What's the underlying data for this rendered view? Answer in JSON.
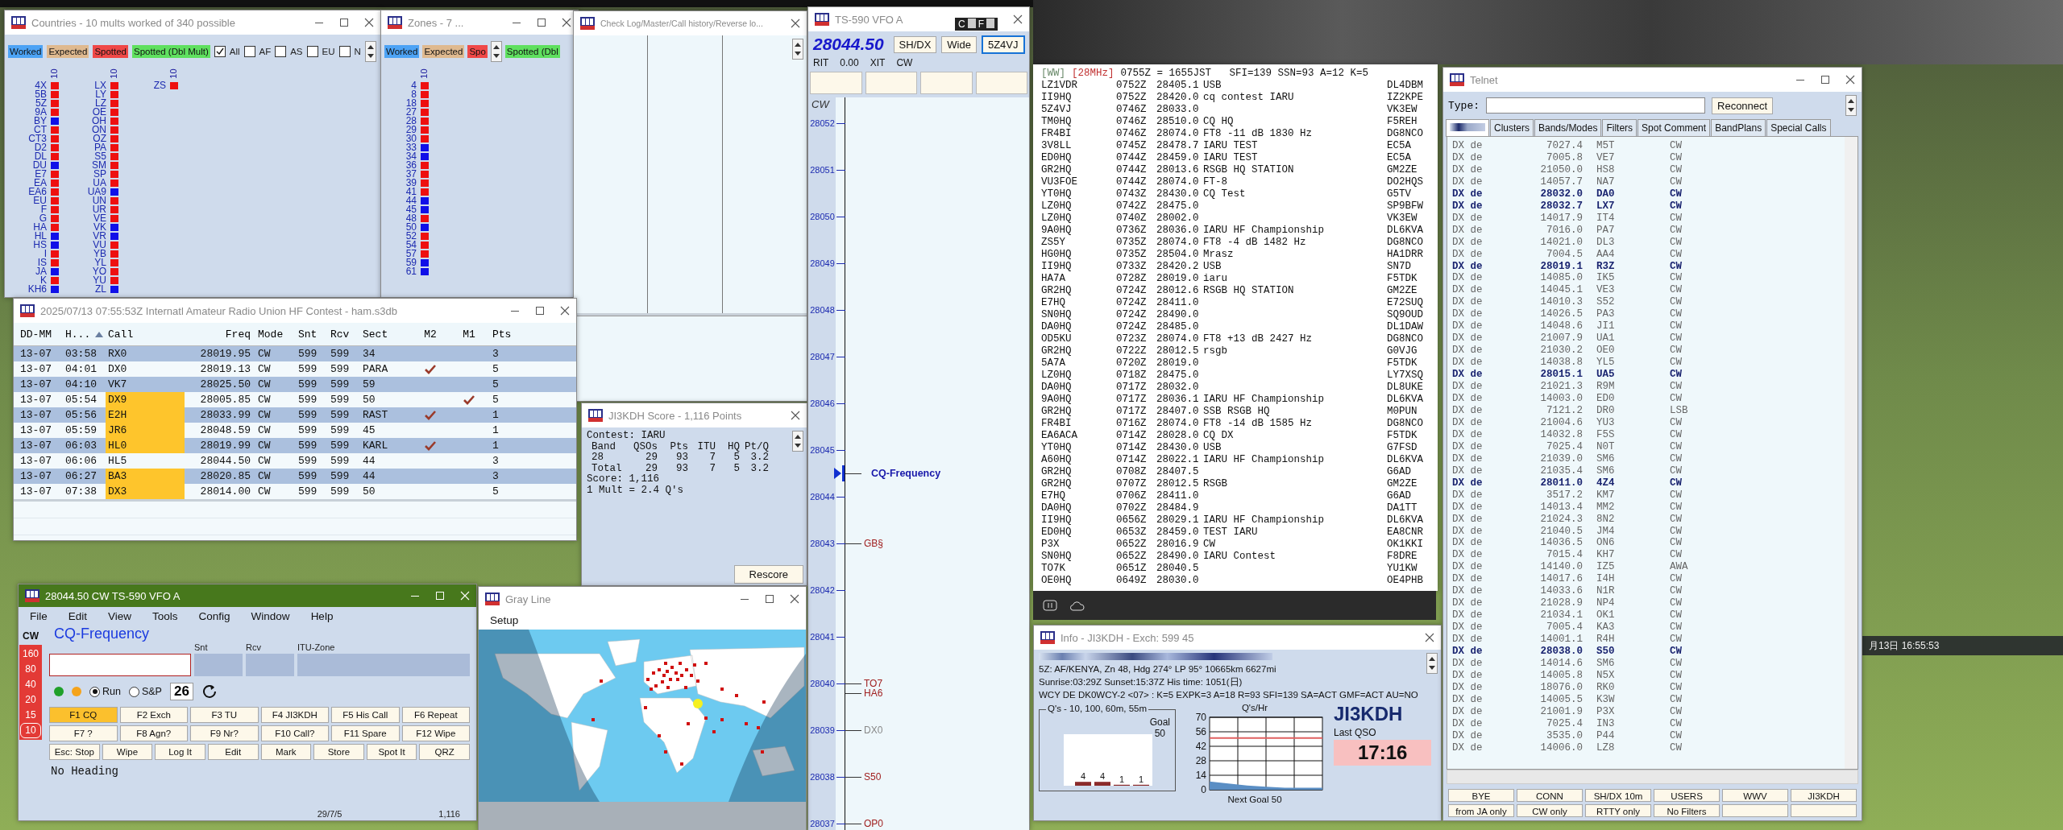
{
  "countries": {
    "title": "Countries - 10 mults worked of 340 possible",
    "legend": [
      {
        "label": "Worked",
        "color": "#4da3f5"
      },
      {
        "label": "Expected",
        "color": "#dfb98f"
      },
      {
        "label": "Spotted",
        "color": "#f04848"
      },
      {
        "label": "Spotted (Dbl Mult)",
        "color": "#5fe05f"
      }
    ],
    "filters": [
      {
        "label": "All",
        "checked": true
      },
      {
        "label": "AF",
        "checked": false
      },
      {
        "label": "AS",
        "checked": false
      },
      {
        "label": "EU",
        "checked": false
      },
      {
        "label": "N",
        "checked": false
      }
    ],
    "columns": [
      {
        "header": "10",
        "items": [
          {
            "label": "4X",
            "color": "#ee1010"
          },
          {
            "label": "5B",
            "color": "#ee1010"
          },
          {
            "label": "5Z",
            "color": "#ee1010"
          },
          {
            "label": "9A",
            "color": "#ee1010"
          },
          {
            "label": "BY",
            "color": "#1010e8"
          },
          {
            "label": "CT",
            "color": "#ee1010"
          },
          {
            "label": "CT3",
            "color": "#ee1010"
          },
          {
            "label": "D2",
            "color": "#ee1010"
          },
          {
            "label": "DL",
            "color": "#ee1010"
          },
          {
            "label": "DU",
            "color": "#1010e8"
          },
          {
            "label": "E7",
            "color": "#ee1010"
          },
          {
            "label": "EA",
            "color": "#ee1010"
          },
          {
            "label": "EA6",
            "color": "#ee1010"
          },
          {
            "label": "EU",
            "color": "#ee1010"
          },
          {
            "label": "F",
            "color": "#ee1010"
          },
          {
            "label": "G",
            "color": "#ee1010"
          },
          {
            "label": "HA",
            "color": "#ee1010"
          },
          {
            "label": "HL",
            "color": "#1010e8"
          },
          {
            "label": "HS",
            "color": "#1010e8"
          },
          {
            "label": "I",
            "color": "#ee1010"
          },
          {
            "label": "IS",
            "color": "#ee1010"
          },
          {
            "label": "JA",
            "color": "#1010e8"
          },
          {
            "label": "K",
            "color": "#ee1010"
          },
          {
            "label": "KH6",
            "color": "#1010e8"
          }
        ]
      },
      {
        "header": "10",
        "items": [
          {
            "label": "LX",
            "color": "#ee1010"
          },
          {
            "label": "LY",
            "color": "#ee1010"
          },
          {
            "label": "LZ",
            "color": "#ee1010"
          },
          {
            "label": "OE",
            "color": "#ee1010"
          },
          {
            "label": "OH",
            "color": "#ee1010"
          },
          {
            "label": "ON",
            "color": "#ee1010"
          },
          {
            "label": "OZ",
            "color": "#ee1010"
          },
          {
            "label": "PA",
            "color": "#ee1010"
          },
          {
            "label": "S5",
            "color": "#ee1010"
          },
          {
            "label": "SM",
            "color": "#ee1010"
          },
          {
            "label": "SP",
            "color": "#ee1010"
          },
          {
            "label": "UA",
            "color": "#ee1010"
          },
          {
            "label": "UA9",
            "color": "#1010e8"
          },
          {
            "label": "UN",
            "color": "#ee1010"
          },
          {
            "label": "UR",
            "color": "#ee1010"
          },
          {
            "label": "VE",
            "color": "#ee1010"
          },
          {
            "label": "VK",
            "color": "#1010e8"
          },
          {
            "label": "VR",
            "color": "#1010e8"
          },
          {
            "label": "VU",
            "color": "#ee1010"
          },
          {
            "label": "YB",
            "color": "#ee1010"
          },
          {
            "label": "YL",
            "color": "#ee1010"
          },
          {
            "label": "YO",
            "color": "#ee1010"
          },
          {
            "label": "YU",
            "color": "#ee1010"
          },
          {
            "label": "ZL",
            "color": "#1010e8"
          }
        ]
      },
      {
        "header": "10",
        "items": [
          {
            "label": "ZS",
            "color": "#ee1010"
          }
        ]
      }
    ]
  },
  "zones": {
    "title": "Zones - 7 ...",
    "legend": [
      {
        "label": "Worked",
        "color": "#4da3f5"
      },
      {
        "label": "Expected",
        "color": "#dfb98f"
      },
      {
        "label": "Spo",
        "color": "#f04848"
      },
      {
        "label": "Spotted (Dbl",
        "color": "#5fe05f"
      }
    ],
    "columns": [
      {
        "header": "10",
        "items": [
          {
            "label": "4",
            "color": "#ee1010"
          },
          {
            "label": "8",
            "color": "#ee1010"
          },
          {
            "label": "18",
            "color": "#ee1010"
          },
          {
            "label": "27",
            "color": "#ee1010"
          },
          {
            "label": "28",
            "color": "#ee1010"
          },
          {
            "label": "29",
            "color": "#ee1010"
          },
          {
            "label": "30",
            "color": "#ee1010"
          },
          {
            "label": "33",
            "color": "#1010e8"
          },
          {
            "label": "34",
            "color": "#1010e8"
          },
          {
            "label": "36",
            "color": "#ee1010"
          },
          {
            "label": "37",
            "color": "#ee1010"
          },
          {
            "label": "39",
            "color": "#ee1010"
          },
          {
            "label": "41",
            "color": "#ee1010"
          },
          {
            "label": "44",
            "color": "#1010e8"
          },
          {
            "label": "45",
            "color": "#1010e8"
          },
          {
            "label": "48",
            "color": "#ee1010"
          },
          {
            "label": "50",
            "color": "#1010e8"
          },
          {
            "label": "52",
            "color": "#ee1010"
          },
          {
            "label": "54",
            "color": "#ee1010"
          },
          {
            "label": "57",
            "color": "#ee1010"
          },
          {
            "label": "59",
            "color": "#1010e8"
          },
          {
            "label": "61",
            "color": "#1010e8"
          }
        ]
      }
    ]
  },
  "check_log": {
    "title": "Check Log/Master/Call history/Reverse lo..."
  },
  "score": {
    "title": "JI3KDH Score - 1,116 Points",
    "contest": "Contest: IARU",
    "columns": [
      "Band",
      "QSOs",
      "Pts",
      "ITU",
      "HQ",
      "Pt/Q"
    ],
    "rows": [
      [
        "28",
        "29",
        "93",
        "7",
        "5",
        "3.2"
      ],
      [
        "Total",
        "29",
        "93",
        "7",
        "5",
        "3.2"
      ]
    ],
    "summary": [
      "Score: 1,116",
      "1 Mult = 2.4 Q's"
    ],
    "button": "Rescore"
  },
  "vfo": {
    "title": "TS-590 VFO A",
    "overlay": [
      "C",
      "F"
    ],
    "frequency": "28044.50",
    "buttons": [
      {
        "label": "SH/DX",
        "focused": false
      },
      {
        "label": "Wide",
        "focused": false
      },
      {
        "label": "5Z4VJ",
        "focused": true
      }
    ],
    "rit": [
      "RIT",
      "0.00",
      "XIT",
      "CW"
    ],
    "bandmap": {
      "mode": "CW",
      "rows": [
        {
          "tick": "28052"
        },
        {
          "tick": "28051"
        },
        {
          "tick": "28050"
        },
        {
          "tick": "28049"
        },
        {
          "tick": "28048"
        },
        {
          "tick": "28047"
        },
        {
          "tick": "28046"
        },
        {
          "tick": "28045"
        },
        {
          "tick": "28044",
          "spots": [
            {
              "label": "CQ-Frequency",
              "kind": "cq"
            }
          ]
        },
        {
          "tick": "28043",
          "spots": [
            {
              "label": "GB§",
              "kind": "spot",
              "worked": false
            }
          ]
        },
        {
          "tick": "28042"
        },
        {
          "tick": "28041"
        },
        {
          "tick": "28040",
          "spots": [
            {
              "label": "TO7",
              "kind": "spot",
              "worked": false
            },
            {
              "label": "HA6",
              "kind": "spot",
              "worked": false
            }
          ]
        },
        {
          "tick": "28039",
          "spots": [
            {
              "label": "DX0",
              "kind": "spot",
              "worked": true
            }
          ]
        },
        {
          "tick": "28038",
          "spots": [
            {
              "label": "S50",
              "kind": "spot",
              "worked": false
            }
          ]
        },
        {
          "tick": "28037",
          "spots": [
            {
              "label": "OP0",
              "kind": "spot",
              "worked": false
            }
          ]
        }
      ]
    }
  },
  "log": {
    "title": "2025/07/13 07:55:53Z  Internatl Amateur Radio Union HF Contest - ham.s3db",
    "columns": [
      "DD-MM",
      "H...",
      "Call",
      "Freq",
      "Mode",
      "Snt",
      "Rcv",
      "Sect",
      "M2",
      "M1",
      "Pts"
    ],
    "rows": [
      {
        "date": "13-07",
        "time": "03:58",
        "call": "RX0",
        "freq": "28019.95",
        "mode": "CW",
        "snt": "599",
        "rcv": "599",
        "sect": "34",
        "m2": false,
        "m1": false,
        "pts": "3",
        "highlight": false
      },
      {
        "date": "13-07",
        "time": "04:01",
        "call": "DX0",
        "freq": "28019.13",
        "mode": "CW",
        "snt": "599",
        "rcv": "599",
        "sect": "PARA",
        "m2": true,
        "m1": false,
        "pts": "5",
        "highlight": false
      },
      {
        "date": "13-07",
        "time": "04:10",
        "call": "VK7",
        "freq": "28025.50",
        "mode": "CW",
        "snt": "599",
        "rcv": "599",
        "sect": "59",
        "m2": false,
        "m1": false,
        "pts": "5",
        "highlight": false
      },
      {
        "date": "13-07",
        "time": "05:54",
        "call": "DX9",
        "freq": "28005.85",
        "mode": "CW",
        "snt": "599",
        "rcv": "599",
        "sect": "50",
        "m2": false,
        "m1": true,
        "pts": "5",
        "highlight": true
      },
      {
        "date": "13-07",
        "time": "05:56",
        "call": "E2H",
        "freq": "28033.99",
        "mode": "CW",
        "snt": "599",
        "rcv": "599",
        "sect": "RAST",
        "m2": true,
        "m1": false,
        "pts": "1",
        "highlight": true
      },
      {
        "date": "13-07",
        "time": "05:59",
        "call": "JR6",
        "freq": "28048.59",
        "mode": "CW",
        "snt": "599",
        "rcv": "599",
        "sect": "45",
        "m2": false,
        "m1": false,
        "pts": "1",
        "highlight": true
      },
      {
        "date": "13-07",
        "time": "06:03",
        "call": "HL0",
        "freq": "28019.99",
        "mode": "CW",
        "snt": "599",
        "rcv": "599",
        "sect": "KARL",
        "m2": true,
        "m1": false,
        "pts": "1",
        "highlight": true
      },
      {
        "date": "13-07",
        "time": "06:06",
        "call": "HL5",
        "freq": "28044.50",
        "mode": "CW",
        "snt": "599",
        "rcv": "599",
        "sect": "44",
        "m2": false,
        "m1": false,
        "pts": "3",
        "highlight": false
      },
      {
        "date": "13-07",
        "time": "06:27",
        "call": "BA3",
        "freq": "28020.85",
        "mode": "CW",
        "snt": "599",
        "rcv": "599",
        "sect": "44",
        "m2": false,
        "m1": false,
        "pts": "3",
        "highlight": true
      },
      {
        "date": "13-07",
        "time": "07:38",
        "call": "DX3",
        "freq": "28014.00",
        "mode": "CW",
        "snt": "599",
        "rcv": "599",
        "sect": "50",
        "m2": false,
        "m1": false,
        "pts": "5",
        "highlight": true
      }
    ]
  },
  "entry": {
    "title": "28044.50 CW TS-590 VFO A",
    "menu": [
      "File",
      "Edit",
      "View",
      "Tools",
      "Config",
      "Window",
      "Help"
    ],
    "mode": "CW",
    "bands": [
      {
        "label": "160",
        "selected": false
      },
      {
        "label": "80",
        "selected": false
      },
      {
        "label": "40",
        "selected": false
      },
      {
        "label": "20",
        "selected": false
      },
      {
        "label": "15",
        "selected": false
      },
      {
        "label": "10",
        "selected": true
      }
    ],
    "call_label": "CQ-Frequency",
    "field_labels": [
      "Snt",
      "Rcv",
      "ITU-Zone"
    ],
    "radios": [
      {
        "label": "Run",
        "selected": true
      },
      {
        "label": "S&P",
        "selected": false
      }
    ],
    "counter": "26",
    "keys": [
      [
        {
          "label": "F1 CQ",
          "selected": true
        },
        {
          "label": "F2 Exch",
          "selected": false
        },
        {
          "label": "F3 TU",
          "selected": false
        },
        {
          "label": "F4 JI3KDH",
          "selected": false
        },
        {
          "label": "F5 His Call",
          "selected": false
        },
        {
          "label": "F6 Repeat",
          "selected": false
        }
      ],
      [
        {
          "label": "F7 ?",
          "selected": false
        },
        {
          "label": "F8 Agn?",
          "selected": false
        },
        {
          "label": "F9 Nr?",
          "selected": false
        },
        {
          "label": "F10 Call?",
          "selected": false
        },
        {
          "label": "F11 Spare",
          "selected": false
        },
        {
          "label": "F12 Wipe",
          "selected": false
        }
      ],
      [
        {
          "label": "Esc: Stop",
          "selected": false
        },
        {
          "label": "Wipe",
          "selected": false
        },
        {
          "label": "Log It",
          "selected": false
        },
        {
          "label": "Edit",
          "selected": false
        },
        {
          "label": "Mark",
          "selected": false
        },
        {
          "label": "Store",
          "selected": false
        },
        {
          "label": "Spot It",
          "selected": false
        },
        {
          "label": "QRZ",
          "selected": false
        }
      ]
    ],
    "heading": "No Heading",
    "status": [
      "29/7/5",
      "1,116"
    ]
  },
  "gray_line": {
    "title": "Gray Line",
    "menu": [
      "Setup"
    ]
  },
  "spots": {
    "header": {
      "tag": "[WW]",
      "band": "[28MHz]",
      "text": "0755Z = 1655JST   SFI=139 SSN=93 A=12 K=5"
    },
    "rows": [
      {
        "call": "LZ1VDR",
        "time": "0752Z",
        "freq": "28405.1",
        "comment": "USB",
        "spotter": "DL4DBM"
      },
      {
        "call": "II9HQ",
        "time": "0752Z",
        "freq": "28420.0",
        "comment": "cq contest IARU",
        "spotter": "IZ2KPE"
      },
      {
        "call": "5Z4VJ",
        "time": "0746Z",
        "freq": "28033.0",
        "spotter": "VK3EW"
      },
      {
        "call": "TM0HQ",
        "time": "0746Z",
        "freq": "28510.0",
        "comment": "CQ HQ",
        "spotter": "F5REH"
      },
      {
        "call": "FR4BI",
        "time": "0746Z",
        "freq": "28074.0",
        "comment": "FT8 -11 dB 1830 Hz",
        "spotter": "DG8NCO"
      },
      {
        "call": "3V8LL",
        "time": "0745Z",
        "freq": "28478.7",
        "comment": "IARU TEST",
        "spotter": "EC5A"
      },
      {
        "call": "ED0HQ",
        "time": "0744Z",
        "freq": "28459.0",
        "comment": "IARU TEST",
        "spotter": "EC5A"
      },
      {
        "call": "GR2HQ",
        "time": "0744Z",
        "freq": "28013.6",
        "comment": "RSGB HQ STATION",
        "spotter": "GM2ZE"
      },
      {
        "call": "VU3FOE",
        "time": "0744Z",
        "freq": "28074.0",
        "comment": "FT-8",
        "spotter": "DO2HQS"
      },
      {
        "call": "YT0HQ",
        "time": "0743Z",
        "freq": "28430.0",
        "comment": "CQ Test",
        "spotter": "G5TV"
      },
      {
        "call": "LZ0HQ",
        "time": "0742Z",
        "freq": "28475.0",
        "spotter": "SP9BFW"
      },
      {
        "call": "LZ0HQ",
        "time": "0740Z",
        "freq": "28002.0",
        "spotter": "VK3EW"
      },
      {
        "call": "9A0HQ",
        "time": "0736Z",
        "freq": "28036.0",
        "comment": "IARU HF Championship",
        "spotter": "DL6KVA"
      },
      {
        "call": "ZS5Y",
        "time": "0735Z",
        "freq": "28074.0",
        "comment": "FT8 -4 dB 1482 Hz",
        "spotter": "DG8NCO"
      },
      {
        "call": "HG0HQ",
        "time": "0735Z",
        "freq": "28504.0",
        "comment": "Mrasz",
        "spotter": "HA1DRR"
      },
      {
        "call": "II9HQ",
        "time": "0733Z",
        "freq": "28420.2",
        "comment": "USB",
        "spotter": "SN7D"
      },
      {
        "call": "HA7A",
        "time": "0728Z",
        "freq": "28019.0",
        "comment": "iaru",
        "spotter": "F5TDK"
      },
      {
        "call": "GR2HQ",
        "time": "0724Z",
        "freq": "28012.6",
        "comment": "RSGB HQ STATION",
        "spotter": "GM2ZE"
      },
      {
        "call": "E7HQ",
        "time": "0724Z",
        "freq": "28411.0",
        "spotter": "E72SUQ"
      },
      {
        "call": "SN0HQ",
        "time": "0724Z",
        "freq": "28490.0",
        "spotter": "SQ9OUD"
      },
      {
        "call": "DA0HQ",
        "time": "0724Z",
        "freq": "28485.0",
        "spotter": "DL1DAW"
      },
      {
        "call": "OD5KU",
        "time": "0723Z",
        "freq": "28074.0",
        "comment": "FT8 +13 dB 2427 Hz",
        "spotter": "DG8NCO"
      },
      {
        "call": "GR2HQ",
        "time": "0722Z",
        "freq": "28012.5",
        "comment": "rsgb",
        "spotter": "G0VJG"
      },
      {
        "call": "5A7A",
        "time": "0720Z",
        "freq": "28019.0",
        "spotter": "F5TDK"
      },
      {
        "call": "LZ0HQ",
        "time": "0718Z",
        "freq": "28475.0",
        "spotter": "LY7XSQ"
      },
      {
        "call": "DA0HQ",
        "time": "0717Z",
        "freq": "28032.0",
        "spotter": "DL8UKE"
      },
      {
        "call": "9A0HQ",
        "time": "0717Z",
        "freq": "28036.1",
        "comment": "IARU HF Championship",
        "spotter": "DL6KVA"
      },
      {
        "call": "GR2HQ",
        "time": "0717Z",
        "freq": "28407.0",
        "comment": "SSB RSGB HQ",
        "spotter": "M0PUN"
      },
      {
        "call": "FR4BI",
        "time": "0716Z",
        "freq": "28074.0",
        "comment": "FT8 -14 dB 1585 Hz",
        "spotter": "DG8NCO"
      },
      {
        "call": "EA6ACA",
        "time": "0714Z",
        "freq": "28028.0",
        "comment": "CQ DX",
        "spotter": "F5TDK"
      },
      {
        "call": "YT0HQ",
        "time": "0714Z",
        "freq": "28430.0",
        "comment": "USB",
        "spotter": "G7FSD"
      },
      {
        "call": "A60HQ",
        "time": "0714Z",
        "freq": "28022.1",
        "comment": "IARU HF Championship",
        "spotter": "DL6KVA"
      },
      {
        "call": "GR2HQ",
        "time": "0708Z",
        "freq": "28407.5",
        "spotter": "G6AD"
      },
      {
        "call": "GR2HQ",
        "time": "0707Z",
        "freq": "28012.5",
        "comment": "RSGB",
        "spotter": "GM2ZE"
      },
      {
        "call": "E7HQ",
        "time": "0706Z",
        "freq": "28411.0",
        "spotter": "G6AD"
      },
      {
        "call": "DA0HQ",
        "time": "0702Z",
        "freq": "28484.9",
        "spotter": "DA1TT"
      },
      {
        "call": "II9HQ",
        "time": "0656Z",
        "freq": "28029.1",
        "comment": "IARU HF Championship",
        "spotter": "DL6KVA"
      },
      {
        "call": "ED0HQ",
        "time": "0653Z",
        "freq": "28459.0",
        "comment": "TEST IARU",
        "spotter": "EA8CNR"
      },
      {
        "call": "P3X",
        "time": "0652Z",
        "freq": "28016.9",
        "comment": "CW",
        "spotter": "OK1KKI"
      },
      {
        "call": "SN0HQ",
        "time": "0652Z",
        "freq": "28490.0",
        "comment": "IARU Contest",
        "spotter": "F8DRE"
      },
      {
        "call": "TO7K",
        "time": "0651Z",
        "freq": "28040.5",
        "spotter": "YU1KW"
      },
      {
        "call": "OE0HQ",
        "time": "0649Z",
        "freq": "28030.0",
        "spotter": "OE4PHB"
      }
    ]
  },
  "info": {
    "title": "Info - JI3KDH - Exch: 599 45",
    "lines": [
      "5Z: AF/KENYA, Zn 48, Hdg 274° LP 95° 10665km 6627mi",
      "Sunrise:03:29Z Sunset:15:37Z His time: 1051(日)",
      "WCY DE DK0WCY-2 <07> : K=5 EXPK=3 A=18 R=93 SFI=139 SA=ACT GMF=ACT AU=NO"
    ],
    "qs_chart": {
      "title": "Q's - 10, 100, 60m, 55m",
      "goal_label": "Goal",
      "goal_value": "50",
      "bar_labels": [
        "4",
        "4",
        "1",
        "1"
      ]
    },
    "rate_chart": {
      "chart_data": {
        "type": "area",
        "title": "Q's/Hr",
        "xlabel": "Next Goal 50",
        "categories": [
          null,
          null,
          null,
          null,
          null,
          null,
          null
        ],
        "values": [
          8,
          6,
          4,
          3,
          2,
          2,
          2
        ],
        "ylim": [
          0,
          70
        ],
        "yticks": [
          0,
          14,
          28,
          42,
          56,
          70
        ],
        "grid": true,
        "ref_lines": [
          {
            "axis": "y",
            "value": 50
          }
        ]
      }
    },
    "callsign": "JI3KDH",
    "last_label": "Last QSO",
    "last_time": "17:16"
  },
  "telnet": {
    "title": "Telnet",
    "type_label": "Type:",
    "reconnect": "Reconnect",
    "tabs": [
      {
        "selected": true
      },
      {
        "label": "Clusters",
        "selected": false
      },
      {
        "label": "Bands/Modes",
        "selected": false
      },
      {
        "label": "Filters",
        "selected": false
      },
      {
        "label": "Spot Comment",
        "selected": false
      },
      {
        "label": "BandPlans",
        "selected": false
      },
      {
        "label": "Special Calls",
        "selected": false
      }
    ],
    "rows": [
      {
        "prefix": "DX de",
        "freq": "7027.4",
        "call": "M5T",
        "mode": "CW",
        "highlight": false
      },
      {
        "prefix": "DX de",
        "freq": "7005.8",
        "call": "VE7",
        "mode": "CW",
        "highlight": false
      },
      {
        "prefix": "DX de",
        "freq": "21050.0",
        "call": "HS8",
        "mode": "CW",
        "highlight": false
      },
      {
        "prefix": "DX de",
        "freq": "14057.7",
        "call": "NA7",
        "mode": "CW",
        "highlight": false
      },
      {
        "prefix": "DX de",
        "freq": "28032.0",
        "call": "DA0",
        "mode": "CW",
        "highlight": true
      },
      {
        "prefix": "DX de",
        "freq": "28032.7",
        "call": "LX7",
        "mode": "CW",
        "highlight": true
      },
      {
        "prefix": "DX de",
        "freq": "14017.9",
        "call": "IT4",
        "mode": "CW",
        "highlight": false
      },
      {
        "prefix": "DX de",
        "freq": "7016.0",
        "call": "PA7",
        "mode": "CW",
        "highlight": false
      },
      {
        "prefix": "DX de",
        "freq": "14021.0",
        "call": "DL3",
        "mode": "CW",
        "highlight": false
      },
      {
        "prefix": "DX de",
        "freq": "7004.5",
        "call": "AA4",
        "mode": "CW",
        "highlight": false
      },
      {
        "prefix": "DX de",
        "freq": "28019.1",
        "call": "R3Z",
        "mode": "CW",
        "highlight": true
      },
      {
        "prefix": "DX de",
        "freq": "14085.0",
        "call": "IK5",
        "mode": "CW",
        "highlight": false
      },
      {
        "prefix": "DX de",
        "freq": "14045.1",
        "call": "VE3",
        "mode": "CW",
        "highlight": false
      },
      {
        "prefix": "DX de",
        "freq": "14010.3",
        "call": "S52",
        "mode": "CW",
        "highlight": false
      },
      {
        "prefix": "DX de",
        "freq": "14026.5",
        "call": "PA3",
        "mode": "CW",
        "highlight": false
      },
      {
        "prefix": "DX de",
        "freq": "14048.6",
        "call": "JI1",
        "mode": "CW",
        "highlight": false
      },
      {
        "prefix": "DX de",
        "freq": "21007.9",
        "call": "UA1",
        "mode": "CW",
        "highlight": false
      },
      {
        "prefix": "DX de",
        "freq": "21030.2",
        "call": "OE0",
        "mode": "CW",
        "highlight": false
      },
      {
        "prefix": "DX de",
        "freq": "14038.8",
        "call": "YL5",
        "mode": "CW",
        "highlight": false
      },
      {
        "prefix": "DX de",
        "freq": "28015.1",
        "call": "UA5",
        "mode": "CW",
        "highlight": true
      },
      {
        "prefix": "DX de",
        "freq": "21021.3",
        "call": "R9M",
        "mode": "CW",
        "highlight": false
      },
      {
        "prefix": "DX de",
        "freq": "14003.0",
        "call": "ED0",
        "mode": "CW",
        "highlight": false
      },
      {
        "prefix": "DX de",
        "freq": "7121.2",
        "call": "DR0",
        "mode": "LSB",
        "highlight": false
      },
      {
        "prefix": "DX de",
        "freq": "21004.6",
        "call": "YU3",
        "mode": "CW",
        "highlight": false
      },
      {
        "prefix": "DX de",
        "freq": "14032.8",
        "call": "F5S",
        "mode": "CW",
        "highlight": false
      },
      {
        "prefix": "DX de",
        "freq": "7025.4",
        "call": "N0T",
        "mode": "CW",
        "highlight": false
      },
      {
        "prefix": "DX de",
        "freq": "21039.0",
        "call": "SM6",
        "mode": "CW",
        "highlight": false
      },
      {
        "prefix": "DX de",
        "freq": "21035.4",
        "call": "SM6",
        "mode": "CW",
        "highlight": false
      },
      {
        "prefix": "DX de",
        "freq": "28011.0",
        "call": "4Z4",
        "mode": "CW",
        "highlight": true
      },
      {
        "prefix": "DX de",
        "freq": "3517.2",
        "call": "KM7",
        "mode": "CW",
        "highlight": false
      },
      {
        "prefix": "DX de",
        "freq": "14013.4",
        "call": "MM2",
        "mode": "CW",
        "highlight": false
      },
      {
        "prefix": "DX de",
        "freq": "21024.3",
        "call": "8N2",
        "mode": "CW",
        "highlight": false
      },
      {
        "prefix": "DX de",
        "freq": "21040.5",
        "call": "JM4",
        "mode": "CW",
        "highlight": false
      },
      {
        "prefix": "DX de",
        "freq": "14036.5",
        "call": "ON6",
        "mode": "CW",
        "highlight": false
      },
      {
        "prefix": "DX de",
        "freq": "7015.4",
        "call": "KH7",
        "mode": "CW",
        "highlight": false
      },
      {
        "prefix": "DX de",
        "freq": "14140.0",
        "call": "IZ5",
        "mode": "AWA",
        "highlight": false
      },
      {
        "prefix": "DX de",
        "freq": "14017.6",
        "call": "I4H",
        "mode": "CW",
        "highlight": false
      },
      {
        "prefix": "DX de",
        "freq": "14033.6",
        "call": "N1R",
        "mode": "CW",
        "highlight": false
      },
      {
        "prefix": "DX de",
        "freq": "21028.9",
        "call": "NP4",
        "mode": "CW",
        "highlight": false
      },
      {
        "prefix": "DX de",
        "freq": "21034.1",
        "call": "OK1",
        "mode": "CW",
        "highlight": false
      },
      {
        "prefix": "DX de",
        "freq": "7005.4",
        "call": "KA3",
        "mode": "CW",
        "highlight": false
      },
      {
        "prefix": "DX de",
        "freq": "14001.1",
        "call": "R4H",
        "mode": "CW",
        "highlight": false
      },
      {
        "prefix": "DX de",
        "freq": "28038.0",
        "call": "S50",
        "mode": "CW",
        "highlight": true
      },
      {
        "prefix": "DX de",
        "freq": "14014.6",
        "call": "SM6",
        "mode": "CW",
        "highlight": false
      },
      {
        "prefix": "DX de",
        "freq": "14005.8",
        "call": "N5X",
        "mode": "CW",
        "highlight": false
      },
      {
        "prefix": "DX de",
        "freq": "18076.0",
        "call": "RK0",
        "mode": "CW",
        "highlight": false
      },
      {
        "prefix": "DX de",
        "freq": "14005.5",
        "call": "K3W",
        "mode": "CW",
        "highlight": false
      },
      {
        "prefix": "DX de",
        "freq": "21001.9",
        "call": "P3X",
        "mode": "CW",
        "highlight": false
      },
      {
        "prefix": "DX de",
        "freq": "7025.4",
        "call": "IN3",
        "mode": "CW",
        "highlight": false
      },
      {
        "prefix": "DX de",
        "freq": "3535.0",
        "call": "P44",
        "mode": "CW",
        "highlight": false
      },
      {
        "prefix": "DX de",
        "freq": "14006.0",
        "call": "LZ8",
        "mode": "CW",
        "highlight": false
      }
    ],
    "buttons": [
      [
        "BYE",
        "CONN",
        "SH/DX 10m",
        "USERS",
        "WWV",
        "JI3KDH"
      ],
      [
        "from JA only",
        "CW only",
        "RTTY only",
        "No Filters"
      ]
    ]
  },
  "clock": "月13日 16:55:53"
}
